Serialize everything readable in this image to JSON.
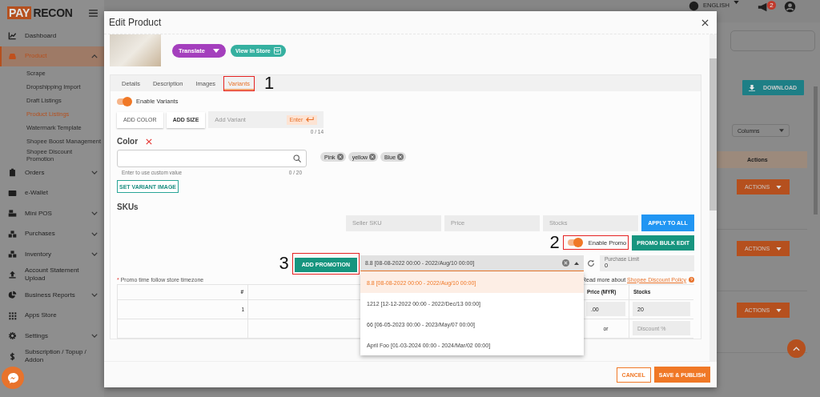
{
  "sidebar": {
    "logo": {
      "badge_text": "PAY",
      "text": "RECON"
    },
    "items": [
      {
        "label": "Dashboard",
        "selected": false,
        "expandable": false
      },
      {
        "label": "Product",
        "selected": true,
        "expandable": true,
        "expanded": true,
        "children": [
          {
            "label": "Scrape",
            "selected": false
          },
          {
            "label": "Dropshipping Import",
            "selected": false
          },
          {
            "label": "Draft Listings",
            "selected": false
          },
          {
            "label": "Product Listings",
            "selected": true
          },
          {
            "label": "Watermark Template",
            "selected": false
          },
          {
            "label": "Shopee Boost Management",
            "selected": false
          },
          {
            "label": "Shopee Discount Promotion",
            "selected": false
          }
        ]
      },
      {
        "label": "Orders",
        "selected": false,
        "expandable": true,
        "expanded": false
      },
      {
        "label": "e-Wallet",
        "selected": false,
        "expandable": false
      },
      {
        "label": "Mini POS",
        "selected": false,
        "expandable": true,
        "expanded": false
      },
      {
        "label": "Purchases",
        "selected": false,
        "expandable": true,
        "expanded": false
      },
      {
        "label": "Inventory",
        "selected": false,
        "expandable": true,
        "expanded": false
      },
      {
        "label": "Account Statement Upload",
        "selected": false,
        "expandable": false
      },
      {
        "label": "Business Reports",
        "selected": false,
        "expandable": true,
        "expanded": false
      },
      {
        "label": "Apps Store",
        "selected": false,
        "expandable": false
      },
      {
        "label": "Settings",
        "selected": false,
        "expandable": true,
        "expanded": false
      },
      {
        "label": "Subscription / Topup / Addon",
        "selected": false,
        "expandable": false
      }
    ]
  },
  "topbar": {
    "language": "ENGLISH",
    "notification_count": "2"
  },
  "page": {
    "download_button": "DOWNLOAD",
    "columns_select": "Columns",
    "table": {
      "columns": [
        "Actions"
      ],
      "rows": [
        {
          "action": "ACTIONS"
        },
        {
          "action": "ACTIONS"
        },
        {
          "action": "ACTIONS"
        }
      ]
    }
  },
  "modal": {
    "title": "Edit Product",
    "translate_button": "Translate",
    "view_store_button": "View In Store",
    "tabs": [
      {
        "label": "Details",
        "selected": false,
        "highlighted": false
      },
      {
        "label": "Description",
        "selected": false,
        "highlighted": false
      },
      {
        "label": "Images",
        "selected": false,
        "highlighted": false
      },
      {
        "label": "Variants",
        "selected": true,
        "highlighted": true
      }
    ],
    "step_labels": [
      "1",
      "2",
      "3"
    ],
    "variants": {
      "enable_toggle": {
        "label": "Enable Variants",
        "on": true
      },
      "add_color_button": "ADD COLOR",
      "add_size_button": "ADD SIZE",
      "variant_field": {
        "placeholder": "Add Variant",
        "counter": "0 / 14"
      },
      "enter_button": "Enter"
    },
    "color": {
      "heading": "Color",
      "search": {
        "hint": "Enter to use custom value",
        "counter": "0 / 20"
      },
      "chips": [
        "Pink",
        "yellow",
        "Blue"
      ],
      "set_image_button": "SET VARIANT IMAGE"
    },
    "skus": {
      "heading": "SKUs",
      "fields": [
        {
          "placeholder": "Seller SKU"
        },
        {
          "placeholder": "Price"
        },
        {
          "placeholder": "Stocks"
        }
      ],
      "apply_button": "APPLY TO ALL",
      "promo_toggle": {
        "label": "Enable Promo",
        "on": true,
        "highlighted": true
      },
      "bulk_edit_button": "PROMO BULK EDIT",
      "add_promotion_button": {
        "label": "ADD PROMOTION",
        "highlighted": true
      },
      "promotion_select": {
        "value": "8.8 [08-08-2022 00:00 - 2022/Aug/10 00:00]",
        "expanded": true,
        "options": [
          {
            "label": "8.8 [08-08-2022 00:00 - 2022/Aug/10 00:00]",
            "selected": true
          },
          {
            "label": "1212 [12-12-2022 00:00 - 2022/Dec/13 00:00]",
            "selected": false
          },
          {
            "label": "66 [06-05-2023 00:00 - 2023/May/07 00:00]",
            "selected": false
          },
          {
            "label": "April Foo [01-03-2024 00:00 - 2024/Mar/02 00:00]",
            "selected": false
          }
        ]
      },
      "purchase_limit": {
        "label": "Purchase Limit",
        "value": "0"
      },
      "required_mark": "*",
      "note": "Promo time follow store timezone",
      "policy_text": "Read more about",
      "policy_link": "Shopee Discount Policy",
      "table": {
        "columns": [
          "#",
          "Price (MYR)",
          "Stocks"
        ],
        "rows": [
          {
            "number": "1",
            "price": ".00",
            "stocks": "20"
          }
        ],
        "discount_row": {
          "or": "or",
          "placeholder": "Discount %"
        }
      }
    },
    "cancel_button": "CANCEL",
    "save_button": "SAVE & PUBLISH"
  }
}
